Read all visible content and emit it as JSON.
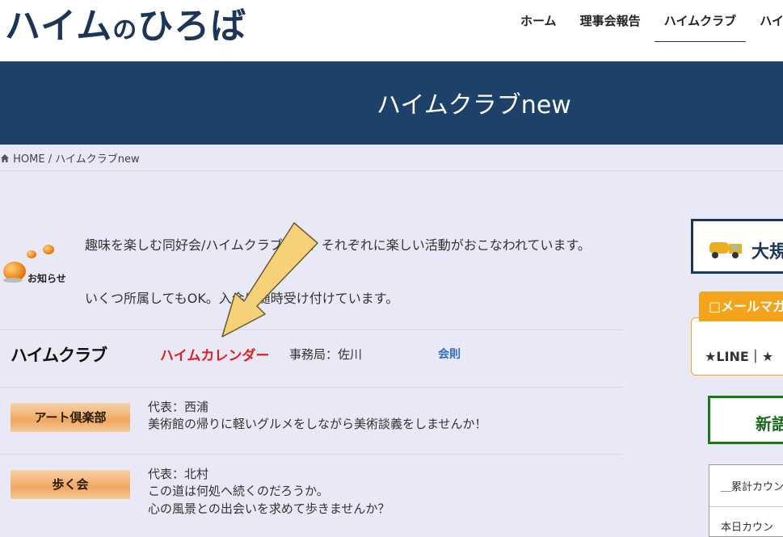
{
  "header": {
    "logo": {
      "part1": "ハイム",
      "part2": "の",
      "part3": "ひろば"
    },
    "nav": [
      {
        "label": "ホーム"
      },
      {
        "label": "理事会報告"
      },
      {
        "label": "ハイムクラブ",
        "active": true
      },
      {
        "label": "ハイム"
      }
    ]
  },
  "hero": {
    "title": "ハイムクラブnew"
  },
  "breadcrumb": {
    "home": "HOME",
    "separator": "/",
    "current": "ハイムクラブnew"
  },
  "intro": {
    "icon_label": "お知らせ",
    "text1": "趣味を楽しむ同好会/ハイムクラブでは、それぞれに楽しい活動がおこなわれています。",
    "text2": "いくつ所属してもOK。入会は随時受け付けています。"
  },
  "club_header": {
    "logo": "ハイムクラブ",
    "calendar_link": "ハイムカレンダー",
    "office": "事務局：佐川",
    "rules_link": "会則"
  },
  "clubs": [
    {
      "name": "アート倶楽部",
      "lines": [
        "代表：西浦",
        "美術館の帰りに軽いグルメをしながら美術談義をしませんか！"
      ]
    },
    {
      "name": "歩く会",
      "lines": [
        "代表：北村",
        "この道は何処へ続くのだろうか。",
        "心の風景との出会いを求めて歩きませんか？"
      ]
    }
  ],
  "sidebar": {
    "banner_text": "大規",
    "mail_tab": "□メールマガ",
    "line_text": "★LINE｜★",
    "green_text": "新語",
    "counter_rows": [
      "＿累計カウン",
      "本日カウン"
    ]
  },
  "colors": {
    "hero_bg": "#1d4169",
    "page_bg": "#e8e8f6",
    "calendar_red": "#e02020",
    "rules_blue": "#2b6fc9",
    "mail_orange": "#f5a31a",
    "arrow_fill": "#f5d27a"
  }
}
